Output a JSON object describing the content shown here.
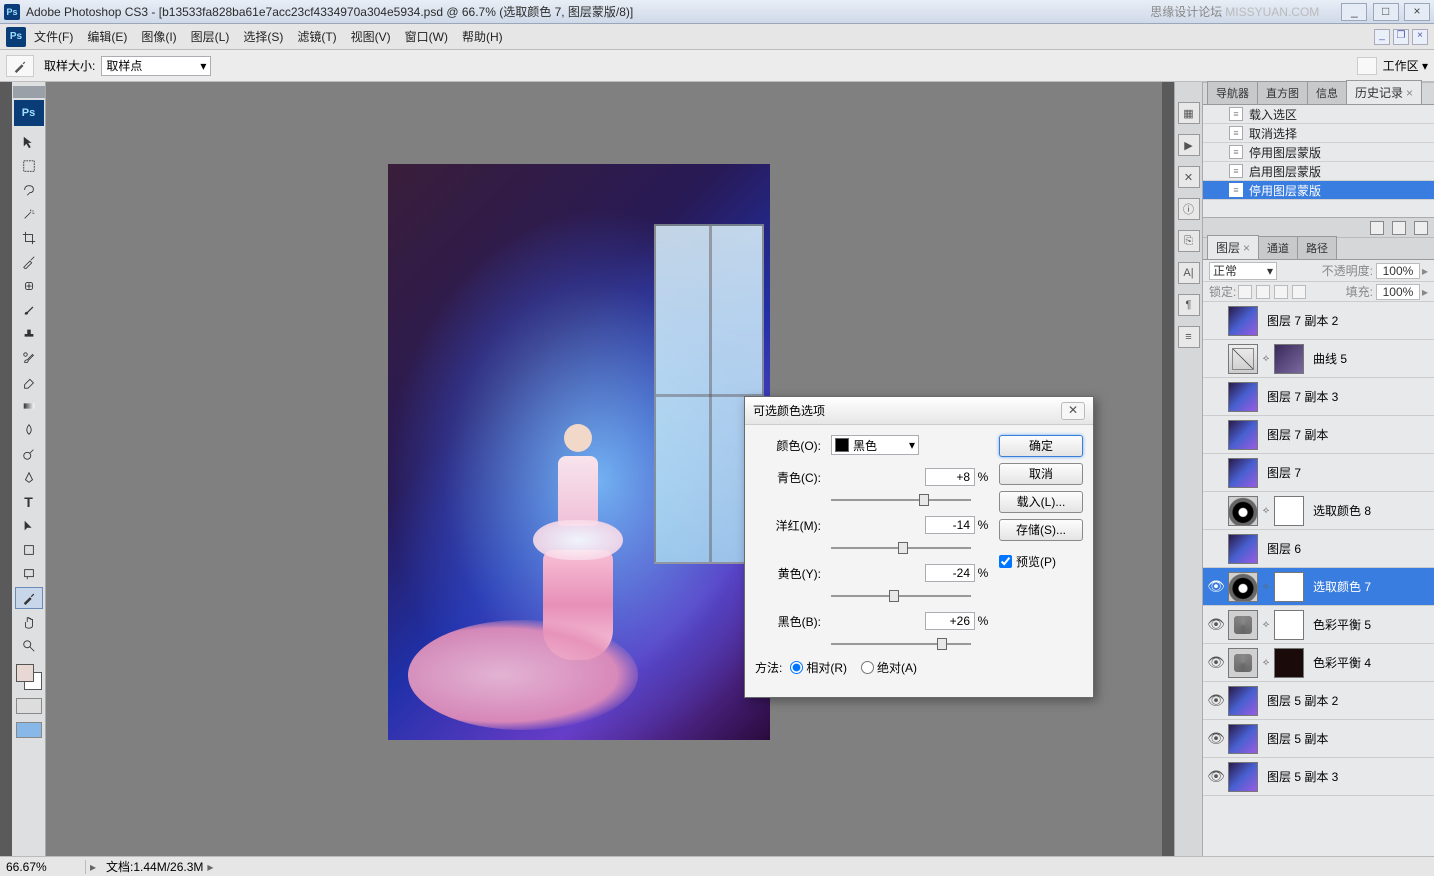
{
  "title": "Adobe Photoshop CS3 - [b13533fa828ba61e7acc23cf4334970a304e5934.psd @ 66.7% (选取颜色 7, 图层蒙版/8)]",
  "watermark": "思缘设计论坛",
  "watermark_url": "MISSYUAN.COM",
  "menu": [
    "文件(F)",
    "编辑(E)",
    "图像(I)",
    "图层(L)",
    "选择(S)",
    "滤镜(T)",
    "视图(V)",
    "窗口(W)",
    "帮助(H)"
  ],
  "options": {
    "sample_label": "取样大小:",
    "sample_value": "取样点",
    "workspace_label": "工作区 ▾"
  },
  "history": {
    "tabs": [
      "导航器",
      "直方图",
      "信息",
      "历史记录"
    ],
    "active_tab": 3,
    "items": [
      "载入选区",
      "取消选择",
      "停用图层蒙版",
      "启用图层蒙版",
      "停用图层蒙版"
    ],
    "selected": 4
  },
  "layerpanel": {
    "tabs": [
      "图层",
      "通道",
      "路径"
    ],
    "active_tab": 0,
    "blend": "正常",
    "opacity_label": "不透明度:",
    "opacity": "100%",
    "lock_label": "锁定:",
    "fill_label": "填充:",
    "fill": "100%"
  },
  "layers": [
    {
      "name": "图层 7 副本 2",
      "type": "img",
      "vis": false
    },
    {
      "name": "曲线 5",
      "type": "curve",
      "mask": "img",
      "vis": false
    },
    {
      "name": "图层 7 副本 3",
      "type": "img",
      "vis": false
    },
    {
      "name": "图层 7 副本",
      "type": "img",
      "vis": false
    },
    {
      "name": "图层 7",
      "type": "img",
      "vis": false
    },
    {
      "name": "选取颜色 8",
      "type": "adj",
      "mask": "white",
      "vis": false
    },
    {
      "name": "图层 6",
      "type": "img",
      "vis": false
    },
    {
      "name": "选取颜色 7",
      "type": "adj",
      "mask": "white",
      "vis": true,
      "sel": true
    },
    {
      "name": "色彩平衡 5",
      "type": "cb",
      "mask": "white",
      "vis": true
    },
    {
      "name": "色彩平衡 4",
      "type": "cb",
      "mask": "dark",
      "vis": true
    },
    {
      "name": "图层 5 副本 2",
      "type": "img",
      "vis": true
    },
    {
      "name": "图层 5 副本",
      "type": "img",
      "vis": true
    },
    {
      "name": "图层 5 副本 3",
      "type": "img",
      "vis": true
    }
  ],
  "dialog": {
    "title": "可选颜色选项",
    "color_label": "颜色(O):",
    "color_value": "黑色",
    "rows": [
      {
        "label": "青色(C):",
        "value": "+8",
        "pos": 55
      },
      {
        "label": "洋红(M):",
        "value": "-14",
        "pos": 42
      },
      {
        "label": "黄色(Y):",
        "value": "-24",
        "pos": 36
      },
      {
        "label": "黑色(B):",
        "value": "+26",
        "pos": 66
      }
    ],
    "method_label": "方法:",
    "relative": "相对(R)",
    "absolute": "绝对(A)",
    "ok": "确定",
    "cancel": "取消",
    "load": "载入(L)...",
    "save": "存储(S)...",
    "preview": "预览(P)"
  },
  "status": {
    "zoom": "66.67%",
    "doc": "文档:1.44M/26.3M"
  }
}
